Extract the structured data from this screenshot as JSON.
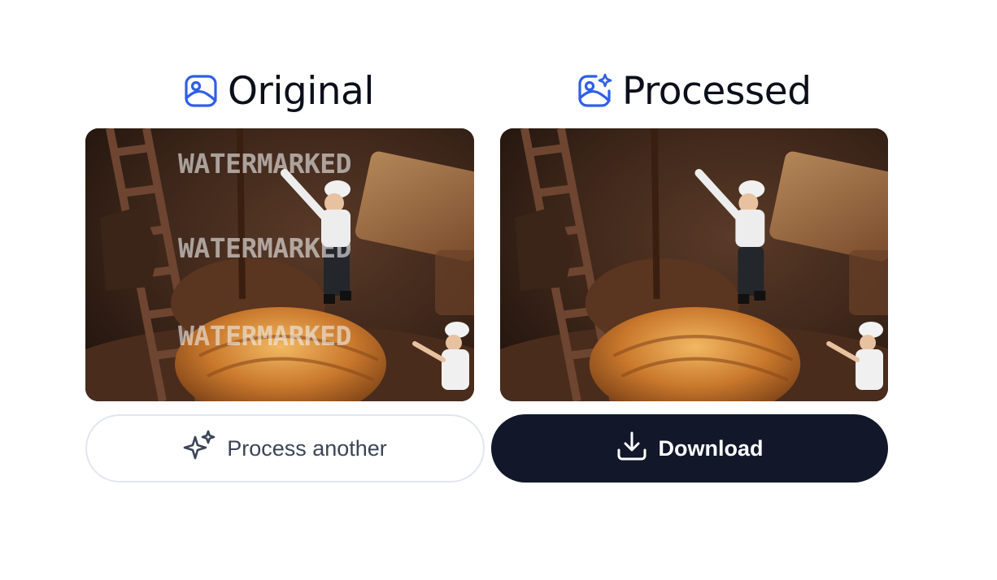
{
  "headers": {
    "original": {
      "label": "Original",
      "icon": "image-icon"
    },
    "processed": {
      "label": "Processed",
      "icon": "image-sparkle-icon"
    }
  },
  "original_image": {
    "watermarks": [
      "WATERMARKED",
      "WATERMARKED",
      "WATERMARKED"
    ]
  },
  "actions": {
    "process_another": {
      "label": "Process another",
      "icon": "sparkles-icon"
    },
    "download": {
      "label": "Download",
      "icon": "download-icon"
    }
  },
  "colors": {
    "accent": "#2f5fe8",
    "primary_button": "#121829",
    "text": "#0b0f19",
    "secondary_text": "#3b4556",
    "border": "#e3e6f0"
  }
}
